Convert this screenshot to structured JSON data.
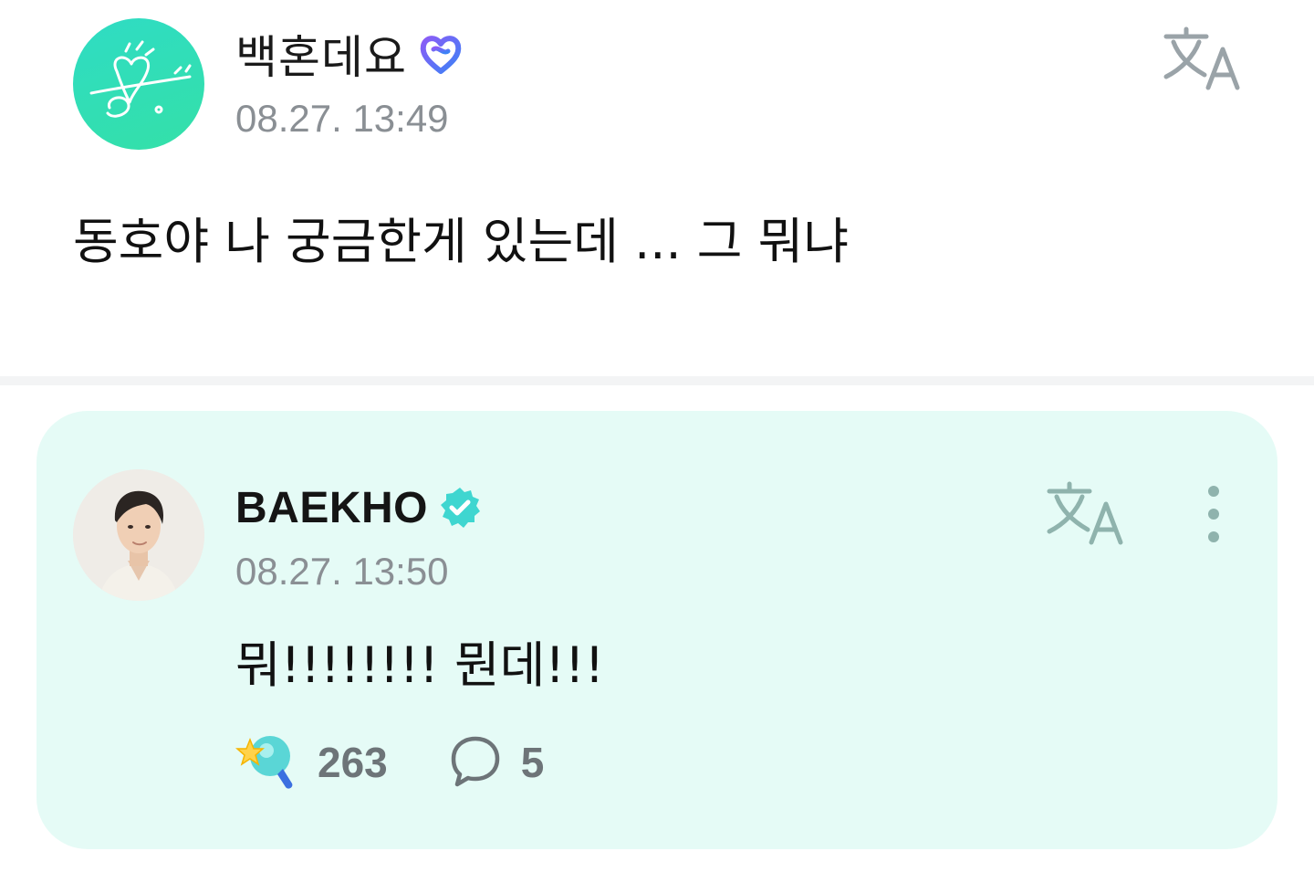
{
  "fan_post": {
    "author": "백혼데요",
    "badge_icon": "heart-membership-icon",
    "timestamp": "08.27. 13:49",
    "translate_icon": "translate-icon",
    "content": "동호야 나 궁금한게 있는데 ... 그 뭐냐"
  },
  "artist_reply": {
    "author": "BAEKHO",
    "badge_icon": "verified-icon",
    "timestamp": "08.27. 13:50",
    "translate_icon": "translate-icon",
    "more_icon": "more-vertical-icon",
    "content": "뭐!!!!!!!! 뭔데!!!",
    "reactions": {
      "like_icon": "star-wand-icon",
      "like_count": "263",
      "comment_icon": "comment-bubble-icon",
      "comment_count": "5"
    }
  },
  "colors": {
    "card_background": "#e5fbf6",
    "accent_teal": "#3fd6d0",
    "muted_text": "#8a8f94",
    "icon_gray": "#9aa6a6",
    "divider": "#f3f4f5"
  }
}
